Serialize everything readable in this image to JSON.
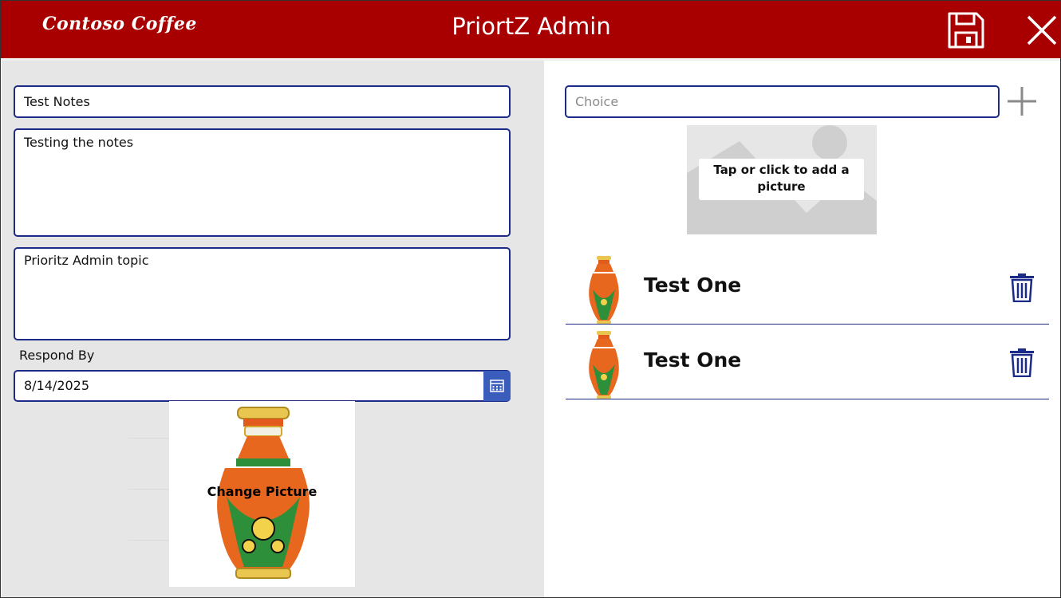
{
  "header": {
    "brand": "Contoso Coffee",
    "title": "PriortZ Admin",
    "save_icon": "save-icon",
    "close_icon": "close-icon",
    "color": "#a80000"
  },
  "form": {
    "title_value": "Test Notes",
    "notes_value": "Testing the notes",
    "topic_value": "Prioritz Admin topic",
    "respond_by_label": "Respond By",
    "respond_by_value": "8/14/2025",
    "change_picture_label": "Change Picture"
  },
  "choices": {
    "placeholder": "Choice",
    "add_icon": "plus-icon",
    "image_placeholder_label": "Tap or click to add a picture",
    "items": [
      {
        "title": "Test One",
        "icon": "trash-icon"
      },
      {
        "title": "Test One",
        "icon": "trash-icon"
      }
    ]
  },
  "colors": {
    "accent": "#1b2b87",
    "panel": "#e6e6e6",
    "calendar_button": "#3a5dbb"
  }
}
